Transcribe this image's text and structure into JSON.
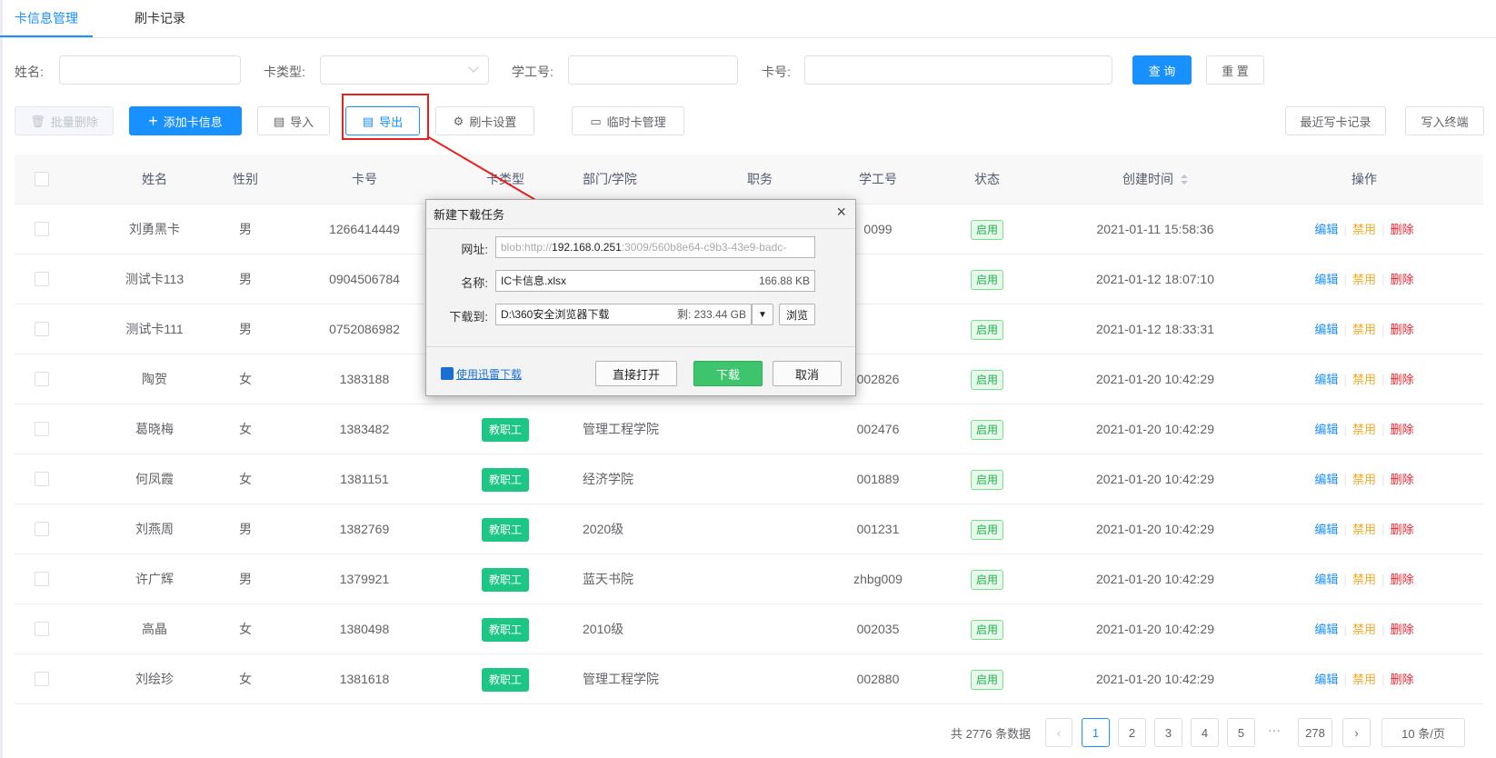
{
  "tabs": [
    {
      "label": "卡信息管理",
      "active": true
    },
    {
      "label": "刷卡记录",
      "active": false
    }
  ],
  "search": {
    "name_label": "姓名:",
    "card_type_label": "卡类型:",
    "student_id_label": "学工号:",
    "card_no_label": "卡号:",
    "query_button": "查 询",
    "reset_button": "重 置"
  },
  "toolbar": {
    "batch_delete": "批量删除",
    "add_card": "添加卡信息",
    "import": "导入",
    "export": "导出",
    "swipe_settings": "刷卡设置",
    "temp_card": "临时卡管理",
    "recent_write": "最近写卡记录",
    "write_terminal": "写入终端"
  },
  "table": {
    "headers": [
      "姓名",
      "性别",
      "卡号",
      "卡类型",
      "部门/学院",
      "职务",
      "学工号",
      "状态",
      "创建时间",
      "操作"
    ],
    "rows": [
      {
        "name": "刘勇黑卡",
        "gender": "男",
        "card_no": "1266414449",
        "card_type": "",
        "dept": "",
        "position": "",
        "student_id": "0099",
        "status": "启用",
        "created": "2021-01-11 15:58:36"
      },
      {
        "name": "测试卡113",
        "gender": "男",
        "card_no": "0904506784",
        "card_type": "",
        "dept": "",
        "position": "",
        "student_id": "",
        "status": "启用",
        "created": "2021-01-12 18:07:10"
      },
      {
        "name": "测试卡111",
        "gender": "男",
        "card_no": "0752086982",
        "card_type": "",
        "dept": "",
        "position": "",
        "student_id": "",
        "status": "启用",
        "created": "2021-01-12 18:33:31"
      },
      {
        "name": "陶贺",
        "gender": "女",
        "card_no": "1383188",
        "card_type": "",
        "dept": "",
        "position": "",
        "student_id": "002826",
        "status": "启用",
        "created": "2021-01-20 10:42:29"
      },
      {
        "name": "葛晓梅",
        "gender": "女",
        "card_no": "1383482",
        "card_type": "教职工",
        "dept": "管理工程学院",
        "position": "",
        "student_id": "002476",
        "status": "启用",
        "created": "2021-01-20 10:42:29"
      },
      {
        "name": "何凤霞",
        "gender": "女",
        "card_no": "1381151",
        "card_type": "教职工",
        "dept": "经济学院",
        "position": "",
        "student_id": "001889",
        "status": "启用",
        "created": "2021-01-20 10:42:29"
      },
      {
        "name": "刘燕周",
        "gender": "男",
        "card_no": "1382769",
        "card_type": "教职工",
        "dept": "2020级",
        "position": "",
        "student_id": "001231",
        "status": "启用",
        "created": "2021-01-20 10:42:29"
      },
      {
        "name": "许广辉",
        "gender": "男",
        "card_no": "1379921",
        "card_type": "教职工",
        "dept": "蓝天书院",
        "position": "",
        "student_id": "zhbg009",
        "status": "启用",
        "created": "2021-01-20 10:42:29"
      },
      {
        "name": "高晶",
        "gender": "女",
        "card_no": "1380498",
        "card_type": "教职工",
        "dept": "2010级",
        "position": "",
        "student_id": "002035",
        "status": "启用",
        "created": "2021-01-20 10:42:29"
      },
      {
        "name": "刘绘珍",
        "gender": "女",
        "card_no": "1381618",
        "card_type": "教职工",
        "dept": "管理工程学院",
        "position": "",
        "student_id": "002880",
        "status": "启用",
        "created": "2021-01-20 10:42:29"
      }
    ],
    "ops": {
      "edit": "编辑",
      "disable": "禁用",
      "delete": "删除"
    }
  },
  "pagination": {
    "total": "共 2776 条数据",
    "pages": [
      "1",
      "2",
      "3",
      "4",
      "5"
    ],
    "dots": "···",
    "last": "278",
    "page_size": "10 条/页"
  },
  "dialog": {
    "title": "新建下载任务",
    "close": "×",
    "url_label": "网址:",
    "url_prefix": "blob:http://",
    "url_host": "192.168.0.251",
    "url_rest": ":3009/560b8e64-c9b3-43e9-badc-",
    "name_label": "名称:",
    "file_name": "IC卡信息.xlsx",
    "file_size": "166.88 KB",
    "save_label": "下载到:",
    "save_path": "D:\\360安全浏览器下载",
    "free_space": "剩: 233.44 GB",
    "browse": "浏览",
    "xunlei": "使用迅雷下载",
    "open_direct": "直接打开",
    "download": "下载",
    "cancel": "取消"
  },
  "colors": {
    "primary": "#1890ff",
    "status_green": "#22b14c",
    "tag_teal": "#1ec685",
    "disable_orange": "#f7a823",
    "delete_red": "#f5222d",
    "highlight_red": "#e8211f"
  }
}
